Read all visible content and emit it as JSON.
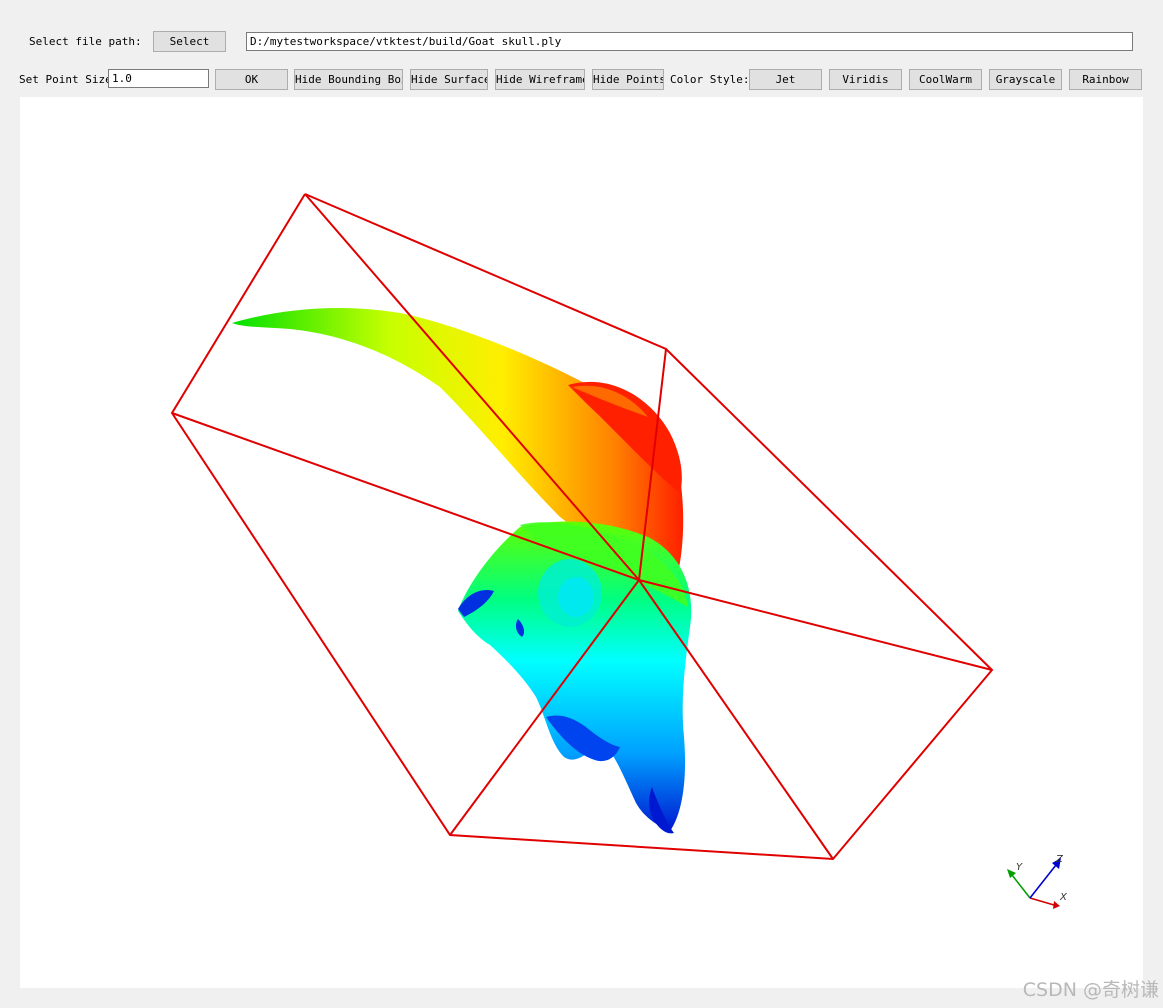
{
  "file_row": {
    "label": "Select file path:",
    "select_button": "Select",
    "path_value": "D:/mytestworkspace/vtktest/build/Goat skull.ply"
  },
  "controls": {
    "point_size_label": "Set Point Size",
    "point_size_value": "1.0",
    "ok_button": "OK",
    "hide_bounding_box": "Hide Bounding Box",
    "hide_surface": "Hide Surface",
    "hide_wireframe": "Hide Wireframe",
    "hide_points": "Hide Points",
    "color_style_label": "Color Style:",
    "color_styles": [
      "Jet",
      "Viridis",
      "CoolWarm",
      "Grayscale",
      "Rainbow"
    ]
  },
  "viewport": {
    "background": "#ffffff",
    "bounding_box_color": "#e00000",
    "colormap": "Jet",
    "axes": {
      "x_label": "X",
      "y_label": "Y",
      "z_label": "Z",
      "x_color": "#d00000",
      "y_color": "#00a000",
      "z_color": "#0000d0"
    }
  },
  "watermark": "CSDN @奇树谦"
}
